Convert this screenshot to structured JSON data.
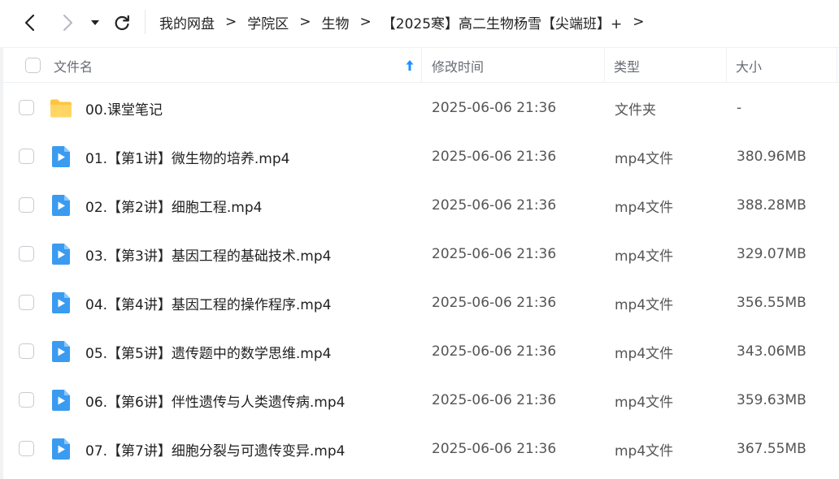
{
  "breadcrumb": [
    "我的网盘",
    "学院区",
    "生物",
    "【2025寒】高二生物杨雪【尖端班】+"
  ],
  "breadcrumb_separator": ">",
  "header": {
    "name": "文件名",
    "mtime": "修改时间",
    "type": "类型",
    "size": "大小"
  },
  "files": [
    {
      "icon": "folder-icon",
      "name": "00.课堂笔记",
      "mtime": "2025-06-06 21:36",
      "type": "文件夹",
      "size": "-"
    },
    {
      "icon": "video-file-icon",
      "name": "01.【第1讲】微生物的培养.mp4",
      "mtime": "2025-06-06 21:36",
      "type": "mp4文件",
      "size": "380.96MB"
    },
    {
      "icon": "video-file-icon",
      "name": "02.【第2讲】细胞工程.mp4",
      "mtime": "2025-06-06 21:36",
      "type": "mp4文件",
      "size": "388.28MB"
    },
    {
      "icon": "video-file-icon",
      "name": "03.【第3讲】基因工程的基础技术.mp4",
      "mtime": "2025-06-06 21:36",
      "type": "mp4文件",
      "size": "329.07MB"
    },
    {
      "icon": "video-file-icon",
      "name": "04.【第4讲】基因工程的操作程序.mp4",
      "mtime": "2025-06-06 21:36",
      "type": "mp4文件",
      "size": "356.55MB"
    },
    {
      "icon": "video-file-icon",
      "name": "05.【第5讲】遗传题中的数学思维.mp4",
      "mtime": "2025-06-06 21:36",
      "type": "mp4文件",
      "size": "343.06MB"
    },
    {
      "icon": "video-file-icon",
      "name": "06.【第6讲】伴性遗传与人类遗传病.mp4",
      "mtime": "2025-06-06 21:36",
      "type": "mp4文件",
      "size": "359.63MB"
    },
    {
      "icon": "video-file-icon",
      "name": "07.【第7讲】细胞分裂与可遗传变异.mp4",
      "mtime": "2025-06-06 21:36",
      "type": "mp4文件",
      "size": "367.55MB"
    }
  ],
  "colors": {
    "accent": "#1e90ff",
    "folder": "#ffc53d",
    "video": "#3a9bf0"
  }
}
